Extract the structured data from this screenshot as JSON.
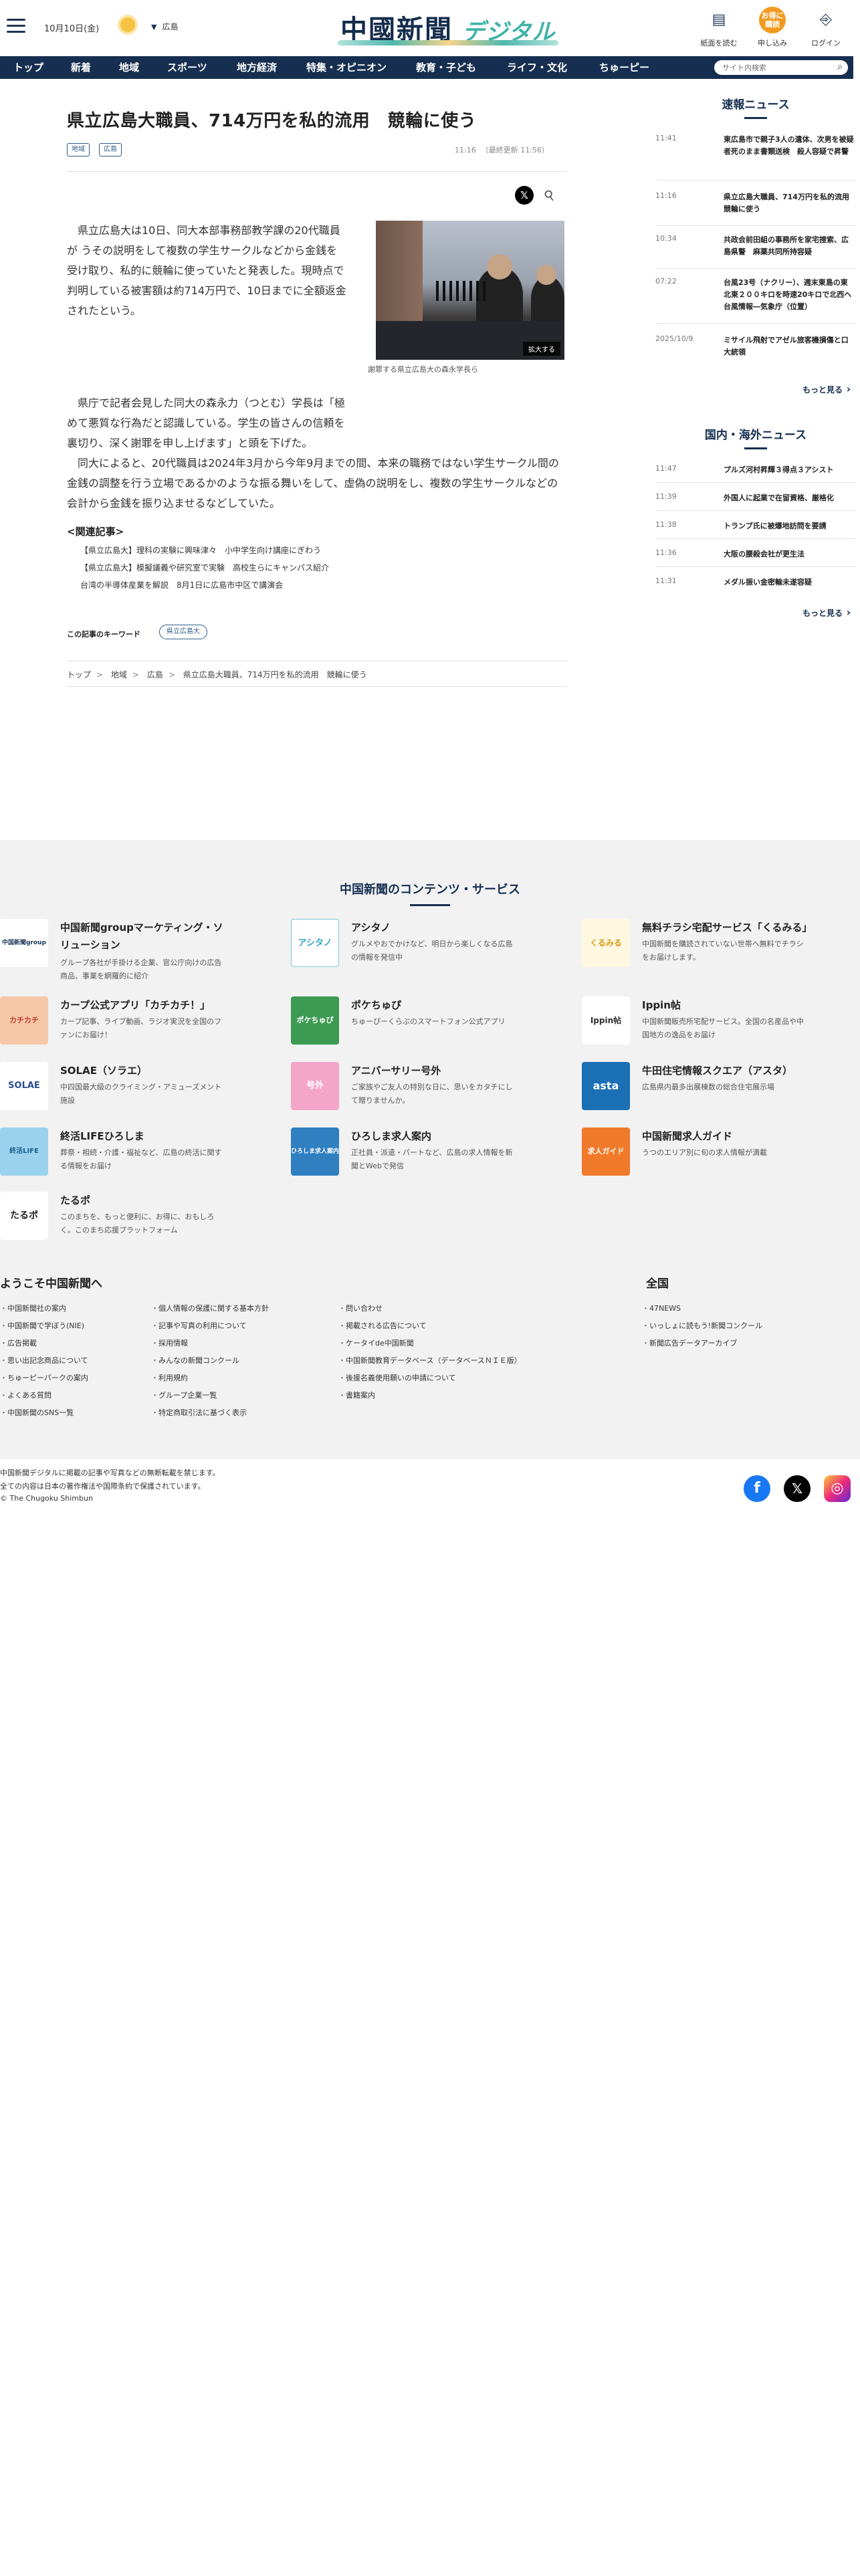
{
  "header": {
    "date": "10月10日(金)",
    "weather_icon": "sun-icon",
    "prefecture": "広島",
    "logo_main": "中國新聞",
    "logo_sub": "デジタル",
    "buttons": [
      {
        "label": "紙面を読む",
        "icon": "book-icon"
      },
      {
        "label": "申し込み",
        "icon": "apply-icon",
        "badge": "お得に購読"
      },
      {
        "label": "ログイン",
        "icon": "login-icon"
      }
    ]
  },
  "nav": {
    "items": [
      "トップ",
      "新着",
      "地域",
      "スポーツ",
      "地方経済",
      "特集・オピニオン",
      "教育・子ども",
      "ライフ・文化",
      "ちゅーピー"
    ],
    "search_placeholder": "サイト内検索"
  },
  "article": {
    "title": "県立広島大職員、714万円を私的流用　競輪に使う",
    "tags": [
      "地域",
      "広島"
    ],
    "time": "11:16",
    "updated": "（最終更新 11:56）",
    "paragraphs": [
      "県立広島大は10日、同大本部事務部教学課の20代職員が うその説明をして複数の学生サークルなどから金銭を受け取り、私的に競輪に使っていたと発表した。現時点で判明している被害額は約714万円で、10日までに全額返金されたという。",
      "県庁で記者会見した同大の森永力（つとむ）学長は「極めて悪質な行為だと認識している。学生の皆さんの信頼を裏切り、深く謝罪を申し上げます」と頭を下げた。",
      "同大によると、20代職員は2024年3月から今年9月までの間、本来の職務ではない学生サークル間の金銭の調整を行う立場であるかのような振る舞いをして、虚偽の説明をし、複数の学生サークルなどの会計から金銭を振り込ませるなどしていた。"
    ],
    "photo_enlarge": "拡大する",
    "photo_caption": "謝罪する県立広島大の森永学長ら",
    "related_title": "<関連記事>",
    "related": [
      "【県立広島大】理科の実験に興味津々　小中学生向け講座にぎわう",
      "【県立広島大】模擬議義や研究室で実験　高校生らにキャンパス紹介",
      "台湾の半導体産業を解説　8月1日に広島市中区で講演会"
    ],
    "keyword_label": "この記事のキーワード",
    "keyword": "県立広島大",
    "breadcrumb": [
      "トップ",
      "地域",
      "広島",
      "県立広島大職員、714万円を私的流用　競輪に使う"
    ]
  },
  "sidebar": {
    "breaking_title": "速報ニュース",
    "breaking": [
      {
        "time": "11:41",
        "title": "東広島市で親子3人の遺体、次男を被疑者死のまま書類送検　殺人容疑で昇警"
      },
      {
        "time": "11:16",
        "title": "県立広島大職員、714万円を私的流用　競輪に使う"
      },
      {
        "time": "10:34",
        "title": "共政会前田組の事務所を家宅捜索、広島県警　麻薬共同所持容疑"
      },
      {
        "time": "07:22",
        "title": "台風23号（ナクリー）、週末東島の東北東２００キロを時速20キロで北西へ　台風情報―気象庁（位置）"
      },
      {
        "time": "2025/10/9",
        "title": "ミサイル飛射でアゼル旅客機損傷と口大統領"
      }
    ],
    "breaking_more": "もっと見る",
    "world_title": "国内・海外ニュース",
    "world": [
      {
        "time": "11:47",
        "title": "プルズ河村昇輝３得点３アシスト"
      },
      {
        "time": "11:39",
        "title": "外国人に起業で在留資格、厳格化"
      },
      {
        "time": "11:38",
        "title": "トランプ氏に被爆地訪問を要請"
      },
      {
        "time": "11:36",
        "title": "大阪の腰殺会社が更生法"
      },
      {
        "time": "11:31",
        "title": "メダル振い金密輸未遂容疑"
      }
    ],
    "world_more": "もっと見る"
  },
  "services": {
    "title": "中国新聞のコンテンツ・サービス",
    "items": [
      {
        "name": "中国新聞groupマーケティング・ソリューション",
        "desc": "グループ各社が手掛ける企業、官公庁向けの広告商品、事業を網羅的に紹介",
        "logo": "中国新聞group"
      },
      {
        "name": "アシタノ",
        "desc": "グルメやおでかけなど、明日から楽しくなる広島の情報を発信中",
        "logo": "アシタノ"
      },
      {
        "name": "無料チラシ宅配サービス「くるみる」",
        "desc": "中国新聞を購読されていない世帯へ無料でチラシをお届けします。",
        "logo": "くるみる"
      },
      {
        "name": "カープ公式アプリ「カチカチ！」",
        "desc": "カープ記事、ライブ動画、ラジオ実況を全国のファンにお届け！",
        "logo": "カチカチ"
      },
      {
        "name": "ポケちゅぴ",
        "desc": "ちゅーぴーくらぶのスマートフォン公式アプリ",
        "logo": "ポケちゅぴ"
      },
      {
        "name": "Ippin帖",
        "desc": "中国新聞販売所宅配サービス。全国の名産品や中国地方の逸品をお届け",
        "logo": "Ippin帖"
      },
      {
        "name": "SOLAE（ソラエ）",
        "desc": "中四国最大級のクライミング・アミューズメント施設",
        "logo": "SOLAE"
      },
      {
        "name": "アニバーサリー号外",
        "desc": "ご家族やご友人の特別な日に、思いをカタチにして贈りませんか。",
        "logo": "号外"
      },
      {
        "name": "牛田住宅情報スクエア（アスタ）",
        "desc": "広島県内最多出展棟数の総合住宅展示場",
        "logo": "asta"
      },
      {
        "name": "終活LIFEひろしま",
        "desc": "葬祭・相続・介護・福祉など、広島の終活に関する情報をお届け",
        "logo": "終活LIFE"
      },
      {
        "name": "ひろしま求人案内",
        "desc": "正社員・派遣・パートなど、広島の求人情報を新聞とWebで発信",
        "logo": "ひろしま求人案内"
      },
      {
        "name": "中国新聞求人ガイド",
        "desc": "うつのエリア別に旬の求人情報が満載",
        "logo": "求人ガイド"
      },
      {
        "name": "たるポ",
        "desc": "このまちを、もっと便利に、お得に、おもしろく。このまち応援プラットフォーム",
        "logo": "たるポ"
      }
    ]
  },
  "footer": {
    "welcome_title": "ようこそ中国新聞へ",
    "zenkoku_title": "全国",
    "col1": [
      "中国新聞社の案内",
      "中国新聞で学ぼう(NIE)",
      "広告掲載",
      "思い出記念商品について",
      "ちゅーピーパークの案内",
      "よくある質問",
      "中国新聞のSNS一覧"
    ],
    "col2": [
      "個人情報の保護に関する基本方針",
      "記事や写真の利用について",
      "採用情報",
      "みんなの新聞コンクール",
      "利用規約",
      "グループ企業一覧",
      "特定商取引法に基づく表示"
    ],
    "col3": [
      "問い合わせ",
      "掲載される広告について",
      "ケータイde中国新聞",
      "中国新聞教育データベース（データベースＮＩＥ版）",
      "後援名義使用願いの申請について",
      "書籍案内"
    ],
    "col4": [
      "47NEWS",
      "いっしょに読もう!新聞コンクール",
      "新聞広告データアーカイブ"
    ],
    "copyright": [
      "中国新聞デジタルに掲載の記事や写真などの無断転載を禁じます。",
      "全ての内容は日本の著作権法や国際条約で保護されています。",
      "© The Chugoku Shimbun"
    ],
    "social": [
      "facebook-icon",
      "x-icon",
      "instagram-icon"
    ]
  },
  "colors": {
    "navy": "#162f50",
    "accent_orange": "#f29a1f",
    "teal": "#3fb3a8",
    "footer_bg": "#f2f2f2"
  }
}
